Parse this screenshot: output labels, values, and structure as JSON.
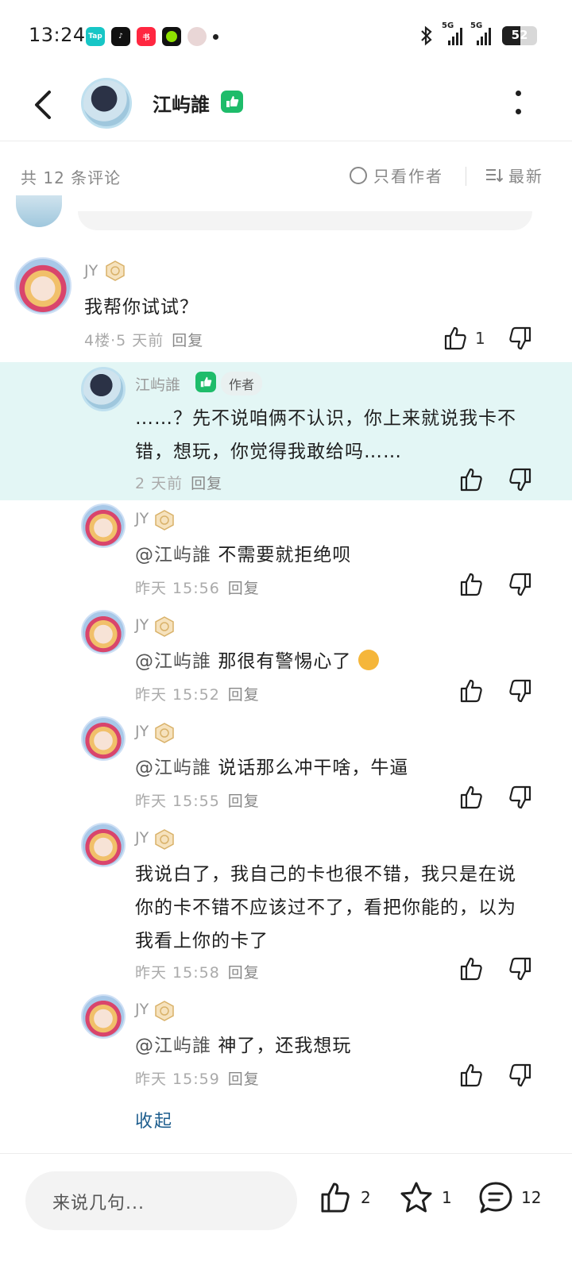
{
  "status_bar": {
    "time": "13:24",
    "apps": [
      "Tap",
      "TikTok",
      "小红书",
      "green-app",
      "avatar-app"
    ],
    "network_1": "5G",
    "network_2": "5G",
    "battery": "52",
    "battery_level": 0.52
  },
  "header": {
    "username": "江屿誰"
  },
  "filter": {
    "count_text": "共 12 条评论",
    "author_only": "只看作者",
    "sort": "最新"
  },
  "comments": [
    {
      "user": "JY",
      "text": "我帮你试试？",
      "meta": "4楼·5 天前",
      "reply": "回复",
      "likes": "1"
    },
    {
      "user": "江屿誰",
      "badge": "作者",
      "text": "……？先不说咱俩不认识，你上来就说我卡不错，想玩，你觉得我敢给吗……",
      "meta": "2 天前",
      "reply": "回复"
    },
    {
      "user": "JY",
      "mention": "@江屿誰",
      "text": "不需要就拒绝呗",
      "meta": "昨天 15:56",
      "reply": "回复"
    },
    {
      "user": "JY",
      "mention": "@江屿誰",
      "text": "那很有警惕心了",
      "meta": "昨天 15:52",
      "reply": "回复"
    },
    {
      "user": "JY",
      "mention": "@江屿誰",
      "text": "说话那么冲干啥，牛逼",
      "meta": "昨天 15:55",
      "reply": "回复"
    },
    {
      "user": "JY",
      "text": "我说白了，我自己的卡也很不错，我只是在说你的卡不错不应该过不了，看把你能的，以为我看上你的卡了",
      "meta": "昨天 15:58",
      "reply": "回复"
    },
    {
      "user": "JY",
      "mention": "@江屿誰",
      "text": "神了，还我想玩",
      "meta": "昨天 15:59",
      "reply": "回复"
    }
  ],
  "collapse_label": "收起",
  "bottom_bar": {
    "placeholder": "来说几句...",
    "likes": "2",
    "favorites": "1",
    "comments": "12"
  },
  "colors": {
    "verify_green": "#1ebc6a",
    "highlight_bg": "#e3f6f5",
    "collapse_link": "#1e5e8e"
  }
}
